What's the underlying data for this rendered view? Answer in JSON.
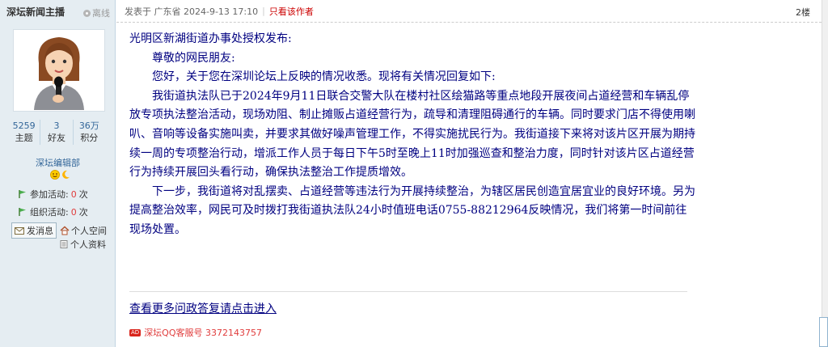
{
  "author": {
    "name": "深坛新闻主播",
    "status": "离线",
    "stats": [
      {
        "value": "5259",
        "label": "主题"
      },
      {
        "value": "3",
        "label": "好友"
      },
      {
        "value": "36万",
        "label": "积分"
      }
    ],
    "group": "深坛编辑部",
    "activities": [
      {
        "label": "参加活动:",
        "count": "0",
        "unit": "次"
      },
      {
        "label": "组织活动:",
        "count": "0",
        "unit": "次"
      }
    ],
    "send_message": "发消息",
    "space_link": "个人空间",
    "profile_link": "个人资料"
  },
  "post": {
    "meta": "发表于 广东省 2024-9-13 17:10",
    "only_author": "只看该作者",
    "floor": "2楼",
    "paragraphs": [
      "光明区新湖街道办事处授权发布:",
      "尊敬的网民朋友:",
      "您好，关于您在深圳论坛上反映的情况收悉。现将有关情况回复如下:",
      "我街道执法队已于2024年9月11日联合交警大队在楼村社区绘猫路等重点地段开展夜间占道经营和车辆乱停放专项执法整治活动，现场劝阻、制止摊贩占道经营行为，疏导和清理阻碍通行的车辆。同时要求门店不得使用喇叭、音响等设备实施叫卖，并要求其做好噪声管理工作，不得实施扰民行为。我街道接下来将对该片区开展为期持续一周的专项整治行动，增派工作人员于每日下午5时至晚上11时加强巡查和整治力度，同时针对该片区占道经营行为持续开展回头看行动，确保执法整治工作提质增效。",
      "下一步，我街道将对乱摆卖、占道经营等违法行为开展持续整治，为辖区居民创造宜居宜业的良好环境。另为提高整治效率，网民可及时拨打我街道执法队24小时值班电话0755-88212964反映情况，我们将第一时间前往现场处置。"
    ],
    "more_link": "查看更多问政答复请点击进入",
    "ad_badge": "AD",
    "ad_text": "深坛QQ客服号 3372143757"
  },
  "colors": {
    "sidebar_bg": "#e5edf2",
    "post_text": "#000080",
    "highlight_red": "#e03c3c",
    "link_blue": "#336699"
  }
}
